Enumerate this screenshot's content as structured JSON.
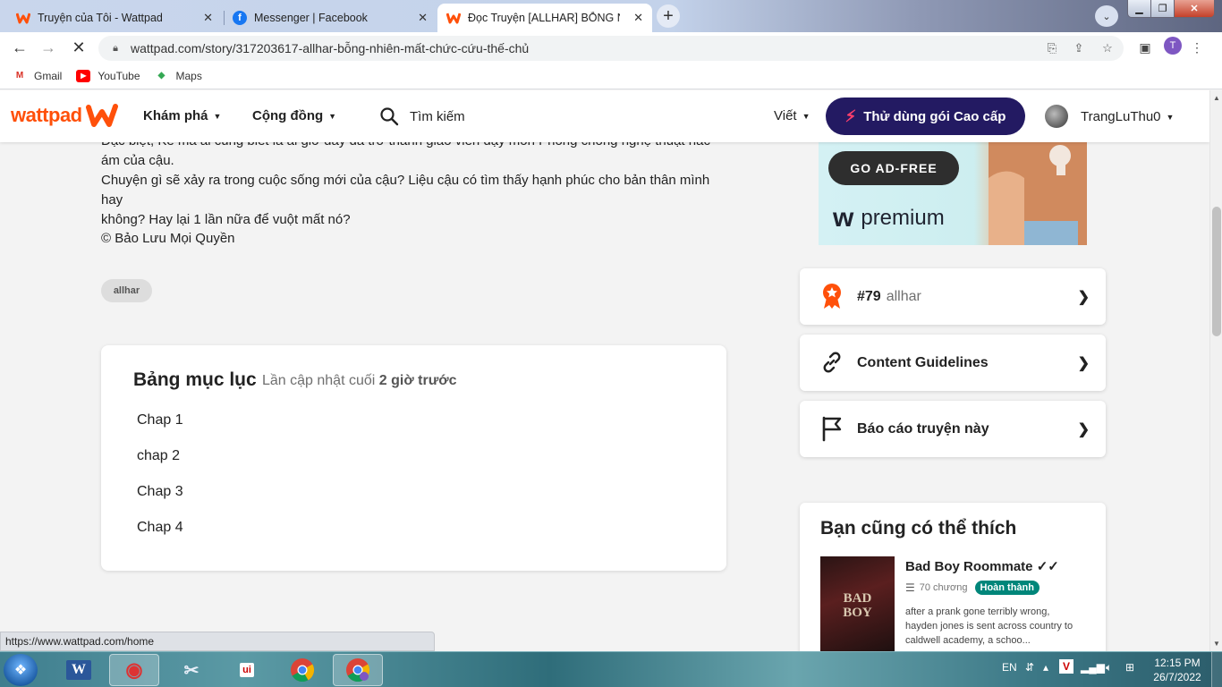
{
  "browser": {
    "tabs": [
      {
        "title": "Truyện của Tôi - Wattpad",
        "favicon": "wattpad-icon"
      },
      {
        "title": "Messenger | Facebook",
        "favicon": "facebook-icon"
      },
      {
        "title": "Đọc Truyện [ALLHAR] BỖNG NHIÊ",
        "favicon": "wattpad-icon"
      }
    ],
    "url": "wattpad.com/story/317203617-allhar-bỗng-nhiên-mất-chức-cứu-thế-chủ",
    "profile_initial": "T",
    "bookmarks": [
      {
        "label": "Gmail",
        "icon": "gmail-icon"
      },
      {
        "label": "YouTube",
        "icon": "youtube-icon"
      },
      {
        "label": "Maps",
        "icon": "maps-icon"
      }
    ],
    "status_url": "https://www.wattpad.com/home"
  },
  "header": {
    "logo_text": "wattpad",
    "nav": [
      "Khám phá",
      "Cộng đồng"
    ],
    "search_label": "Tìm kiếm",
    "write_label": "Viết",
    "premium_label": "Thử dùng gói Cao cấp",
    "username": "TrangLuThu0"
  },
  "story": {
    "description_lines": [
      "Đặc biệt, Kẻ mà ai cũng biết là ai giờ đây đã trở thành giáo viên dạy môn Phòng chống nghệ thuật hắc",
      "ám của cậu.",
      "Chuyện gì sẽ xảy ra trong cuộc sống mới của cậu? Liệu cậu có tìm thấy hạnh phúc cho bản thân mình hay",
      "không? Hay lại 1 lần nữa để vuột mất nó?"
    ],
    "copyright": "© Bảo Lưu Mọi Quyền",
    "tag": "allhar"
  },
  "toc": {
    "title": "Bảng mục lục",
    "updated_prefix": "Lần cập nhật cuối",
    "updated_value": "2 giờ trước",
    "chapters": [
      "Chap 1",
      "chap 2",
      "Chap 3",
      "Chap 4"
    ]
  },
  "ad": {
    "button": "GO AD-FREE",
    "brand": "premium"
  },
  "sidebar": {
    "rank": {
      "number": "#79",
      "tag": "allhar"
    },
    "guidelines": "Content Guidelines",
    "report": "Báo cáo truyện này"
  },
  "recommendations": {
    "title": "Bạn cũng có thể thích",
    "items": [
      {
        "title": "Bad Boy Roommate ✓✓",
        "chapters": "70 chương",
        "status": "Hoàn thành",
        "cover_text_1": "BAD",
        "cover_text_2": "BOY",
        "description": "after a prank gone terribly wrong, hayden jones is sent across country to caldwell academy, a schoo..."
      }
    ]
  },
  "taskbar": {
    "lang": "EN",
    "time": "12:15 PM",
    "date": "26/7/2022"
  },
  "colors": {
    "wattpad_orange": "#ff500a",
    "premium_navy": "#231a62",
    "complete_badge": "#00867a"
  }
}
